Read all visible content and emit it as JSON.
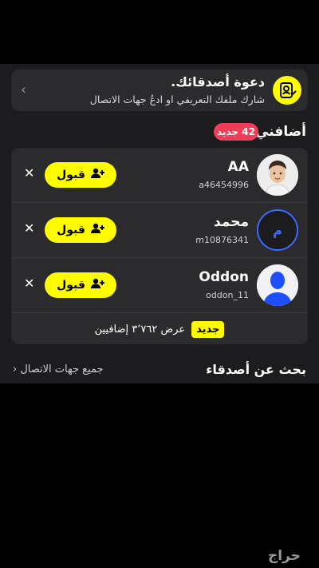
{
  "invite": {
    "title": "دعوة أصدقائك.",
    "subtitle": "شارك ملفك التعريفي او ادعُ جهات الاتصال"
  },
  "added": {
    "heading": "أضافني",
    "badge": "42 جديد"
  },
  "requests": [
    {
      "name": "AA",
      "username": "a46454996",
      "accept_label": "قبول",
      "avatar": "bitmoji-avatar"
    },
    {
      "name": "محمد",
      "username": "m10876341",
      "accept_label": "قبول",
      "avatar_letter": "م"
    },
    {
      "name": "Oddon",
      "username": "oddon_11",
      "accept_label": "قبول",
      "avatar": "default-silhouette"
    }
  ],
  "show_more": {
    "tag": "جديد",
    "text": "عرض ٣٬٧٦٢ إضافيين"
  },
  "find_friends": {
    "heading": "بحث عن أصدقاء",
    "all_contacts": "جميع جهات الاتصال ‹"
  },
  "watermark": "حراج",
  "colors": {
    "accent": "#fffc00",
    "badge": "#f23c57",
    "panel": "#1c1c1e",
    "card": "#2b2b2d",
    "avatar_blue": "#1d4fff"
  }
}
